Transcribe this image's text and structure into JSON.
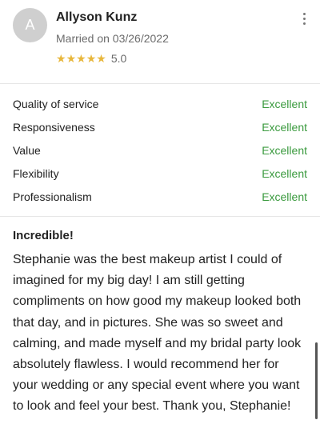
{
  "reviewer": {
    "avatar_initial": "A",
    "name": "Allyson Kunz",
    "married_text": "Married on 03/26/2022",
    "rating_value": "5.0",
    "rating_stars": 5,
    "star_color": "#e8b73c"
  },
  "ratings": [
    {
      "label": "Quality of service",
      "status": "Excellent"
    },
    {
      "label": "Responsiveness",
      "status": "Excellent"
    },
    {
      "label": "Value",
      "status": "Excellent"
    },
    {
      "label": "Flexibility",
      "status": "Excellent"
    },
    {
      "label": "Professionalism",
      "status": "Excellent"
    }
  ],
  "review": {
    "title": "Incredible!",
    "body": "Stephanie was the best makeup artist I could of imagined for my big day! I am still getting compliments on how good my makeup looked both that day, and in pictures. She was so sweet and calming, and made myself and my bridal party look absolutely flawless. I would recommend her for your wedding or any special event where you want to look and feel your best. Thank you, Stephanie!"
  },
  "colors": {
    "status_green": "#3a9a3e",
    "avatar_bg": "#cfcfcf",
    "muted_text": "#6b6b6b"
  },
  "icons": {
    "more": "more-vertical-icon",
    "star": "star-icon"
  }
}
